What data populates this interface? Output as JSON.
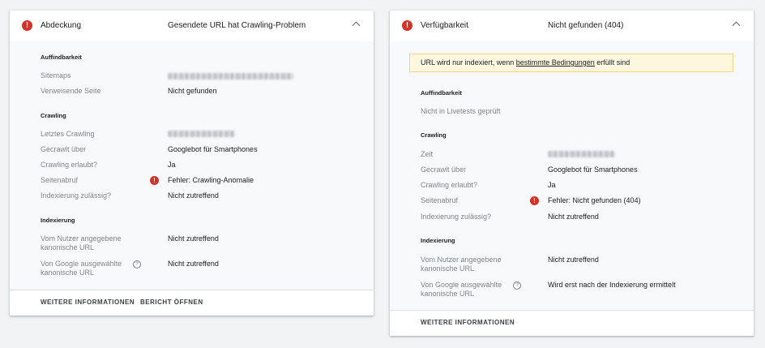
{
  "colors": {
    "error": "#d93025",
    "warning_bg": "#fef7e0",
    "label": "#80868b",
    "text": "#202124",
    "body_bg": "#f8f9fa"
  },
  "left_card": {
    "header": {
      "icon": "error-icon",
      "title": "Abdeckung",
      "value": "Gesendete URL hat Crawling-Problem"
    },
    "sections": {
      "discoverability": {
        "title": "Auffindbarkeit",
        "sitemaps_label": "Sitemaps",
        "referring_page_label": "Verweisende Seite",
        "referring_page_value": "Nicht gefunden"
      },
      "crawling": {
        "title": "Crawling",
        "last_crawl_label": "Letztes Crawling",
        "crawled_as_label": "Gecrawlt über",
        "crawled_as_value": "Googlebot für Smartphones",
        "crawl_allowed_label": "Crawling erlaubt?",
        "crawl_allowed_value": "Ja",
        "page_fetch_label": "Seitenabruf",
        "page_fetch_value": "Fehler: Crawling-Anomalie",
        "indexing_allowed_label": "Indexierung zulässig?",
        "indexing_allowed_value": "Nicht zutreffend"
      },
      "indexing": {
        "title": "Indexierung",
        "user_canonical_label_1": "Vom Nutzer angegebene",
        "user_canonical_label_2": "kanonische URL",
        "user_canonical_value": "Nicht zutreffend",
        "google_canonical_label_1": "Von Google ausgewählte",
        "google_canonical_label_2": "kanonische URL",
        "google_canonical_value": "Nicht zutreffend",
        "help_symbol": "?"
      }
    },
    "footer": {
      "more_info": "WEITERE INFORMATIONEN",
      "open_report": "BERICHT ÖFFNEN"
    }
  },
  "right_card": {
    "header": {
      "icon": "error-icon",
      "title": "Verfügbarkeit",
      "value": "Nicht gefunden (404)"
    },
    "banner": {
      "text_before": "URL wird nur indexiert, wenn ",
      "link_text": "bestimmte Bedingungen",
      "text_after": " erfüllt sind"
    },
    "sections": {
      "discoverability": {
        "title": "Auffindbarkeit",
        "not_tested": "Nicht in Livetests geprüft"
      },
      "crawling": {
        "title": "Crawling",
        "time_label": "Zeit",
        "crawled_as_label": "Gecrawlt über",
        "crawled_as_value": "Googlebot für Smartphones",
        "crawl_allowed_label": "Crawling erlaubt?",
        "crawl_allowed_value": "Ja",
        "page_fetch_label": "Seitenabruf",
        "page_fetch_value": "Fehler: Nicht gefunden (404)",
        "indexing_allowed_label": "Indexierung zulässig?",
        "indexing_allowed_value": "Nicht zutreffend"
      },
      "indexing": {
        "title": "Indexierung",
        "user_canonical_label_1": "Vom Nutzer angegebene",
        "user_canonical_label_2": "kanonische URL",
        "user_canonical_value": "Nicht zutreffend",
        "google_canonical_label_1": "Von Google ausgewählte",
        "google_canonical_label_2": "kanonische URL",
        "google_canonical_value": "Wird erst nach der Indexierung ermittelt",
        "help_symbol": "?"
      }
    },
    "footer": {
      "more_info": "WEITERE INFORMATIONEN"
    }
  },
  "icons": {
    "error_symbol": "!"
  }
}
